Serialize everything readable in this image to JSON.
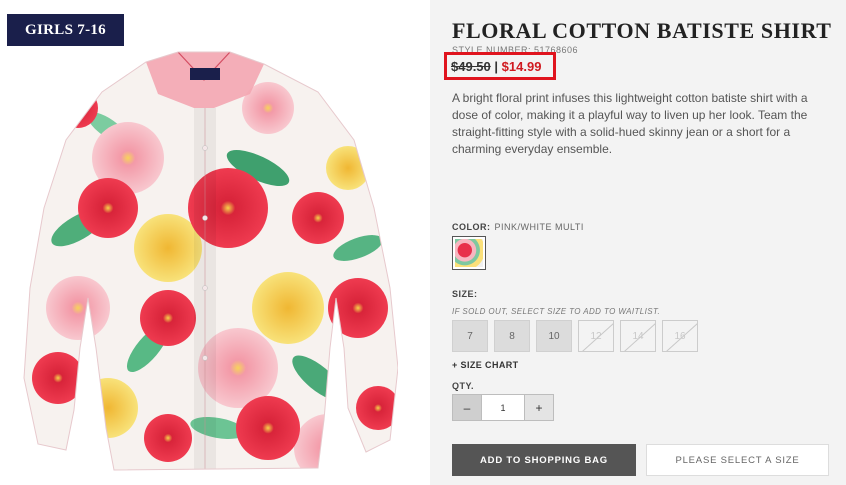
{
  "badge": "GIRLS 7-16",
  "product": {
    "title": "FLORAL COTTON BATISTE SHIRT",
    "style_number": "STYLE NUMBER: 51768606",
    "price_old": "$49.50",
    "price_sep": "|",
    "price_new": "$14.99",
    "description": "A bright floral print infuses this lightweight cotton batiste shirt with a dose of color, making it a playful way to liven up her look. Team the straight-fitting style with a solid-hued skinny jean or a short for a charming everyday ensemble."
  },
  "color": {
    "label": "COLOR:",
    "value": "PINK/WHITE MULTI"
  },
  "size": {
    "label": "SIZE:",
    "note": "IF SOLD OUT, SELECT SIZE TO ADD TO WAITLIST.",
    "options": [
      {
        "label": "7",
        "soldout": false
      },
      {
        "label": "8",
        "soldout": false
      },
      {
        "label": "10",
        "soldout": false
      },
      {
        "label": "12",
        "soldout": true
      },
      {
        "label": "14",
        "soldout": true
      },
      {
        "label": "16",
        "soldout": true
      }
    ],
    "chart_link": "+ SIZE CHART"
  },
  "qty": {
    "label": "QTY.",
    "minus": "–",
    "value": "1",
    "plus": "+"
  },
  "buttons": {
    "add_to_bag": "ADD TO SHOPPING BAG",
    "select_size": "PLEASE SELECT A SIZE"
  },
  "colors": {
    "badge_bg": "#1a1f4b",
    "sale_red": "#d01a20",
    "highlight_border": "#e0141e",
    "panel_bg": "#f3f3f3"
  }
}
